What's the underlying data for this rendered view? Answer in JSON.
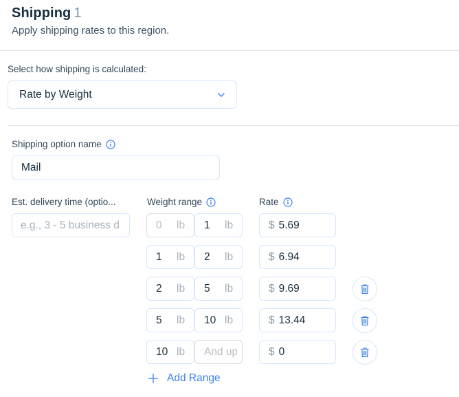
{
  "header": {
    "title": "Shipping",
    "count": "1",
    "subtitle": "Apply shipping rates to this region."
  },
  "calculation": {
    "label": "Select how shipping is calculated:",
    "selected": "Rate by Weight"
  },
  "option_name": {
    "label": "Shipping option name",
    "value": "Mail"
  },
  "delivery": {
    "label": "Est. delivery time (optio...",
    "placeholder": "e.g., 3 - 5 business d"
  },
  "columns": {
    "weight_label": "Weight range",
    "rate_label": "Rate"
  },
  "unit": "lb",
  "currency": "$",
  "rows": [
    {
      "from": "0",
      "from_disabled": true,
      "to": "1",
      "to_placeholder": false,
      "rate": "5.69",
      "deletable": false
    },
    {
      "from": "1",
      "from_disabled": false,
      "to": "2",
      "to_placeholder": false,
      "rate": "6.94",
      "deletable": false
    },
    {
      "from": "2",
      "from_disabled": false,
      "to": "5",
      "to_placeholder": false,
      "rate": "9.69",
      "deletable": true
    },
    {
      "from": "5",
      "from_disabled": false,
      "to": "10",
      "to_placeholder": false,
      "rate": "13.44",
      "deletable": true
    },
    {
      "from": "10",
      "from_disabled": false,
      "to": "And up",
      "to_placeholder": true,
      "rate": "0",
      "deletable": true
    }
  ],
  "add_range_label": "Add Range",
  "colors": {
    "accent": "#3b7ff1",
    "text": "#162d3d",
    "border": "#d6e6fe"
  }
}
